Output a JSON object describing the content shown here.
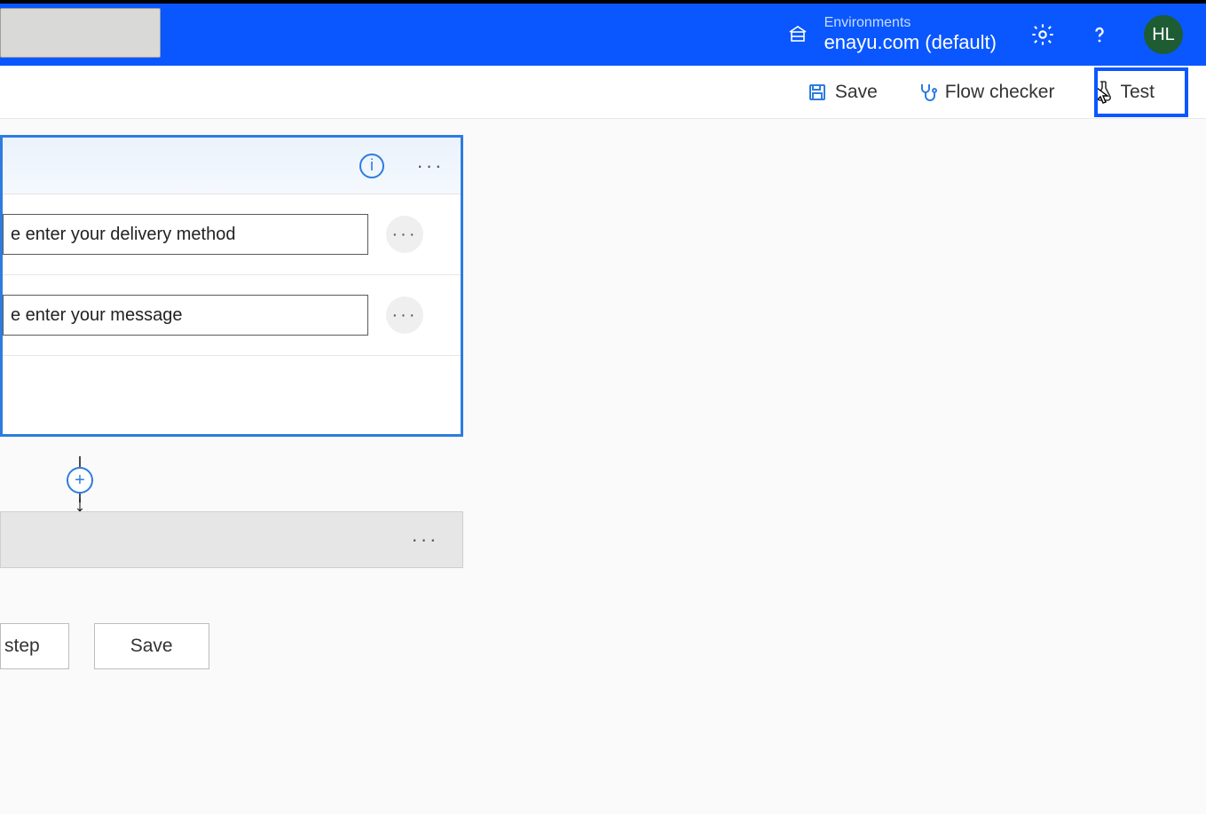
{
  "header": {
    "environments_label": "Environments",
    "environment_name": "enayu.com (default)",
    "avatar_initials": "HL"
  },
  "toolbar": {
    "save_label": "Save",
    "flow_checker_label": "Flow checker",
    "test_label": "Test"
  },
  "trigger": {
    "inputs": [
      {
        "value": "e enter your delivery method"
      },
      {
        "value": "e enter your message"
      }
    ]
  },
  "footer": {
    "new_step_label": "step",
    "save_label": "Save"
  }
}
